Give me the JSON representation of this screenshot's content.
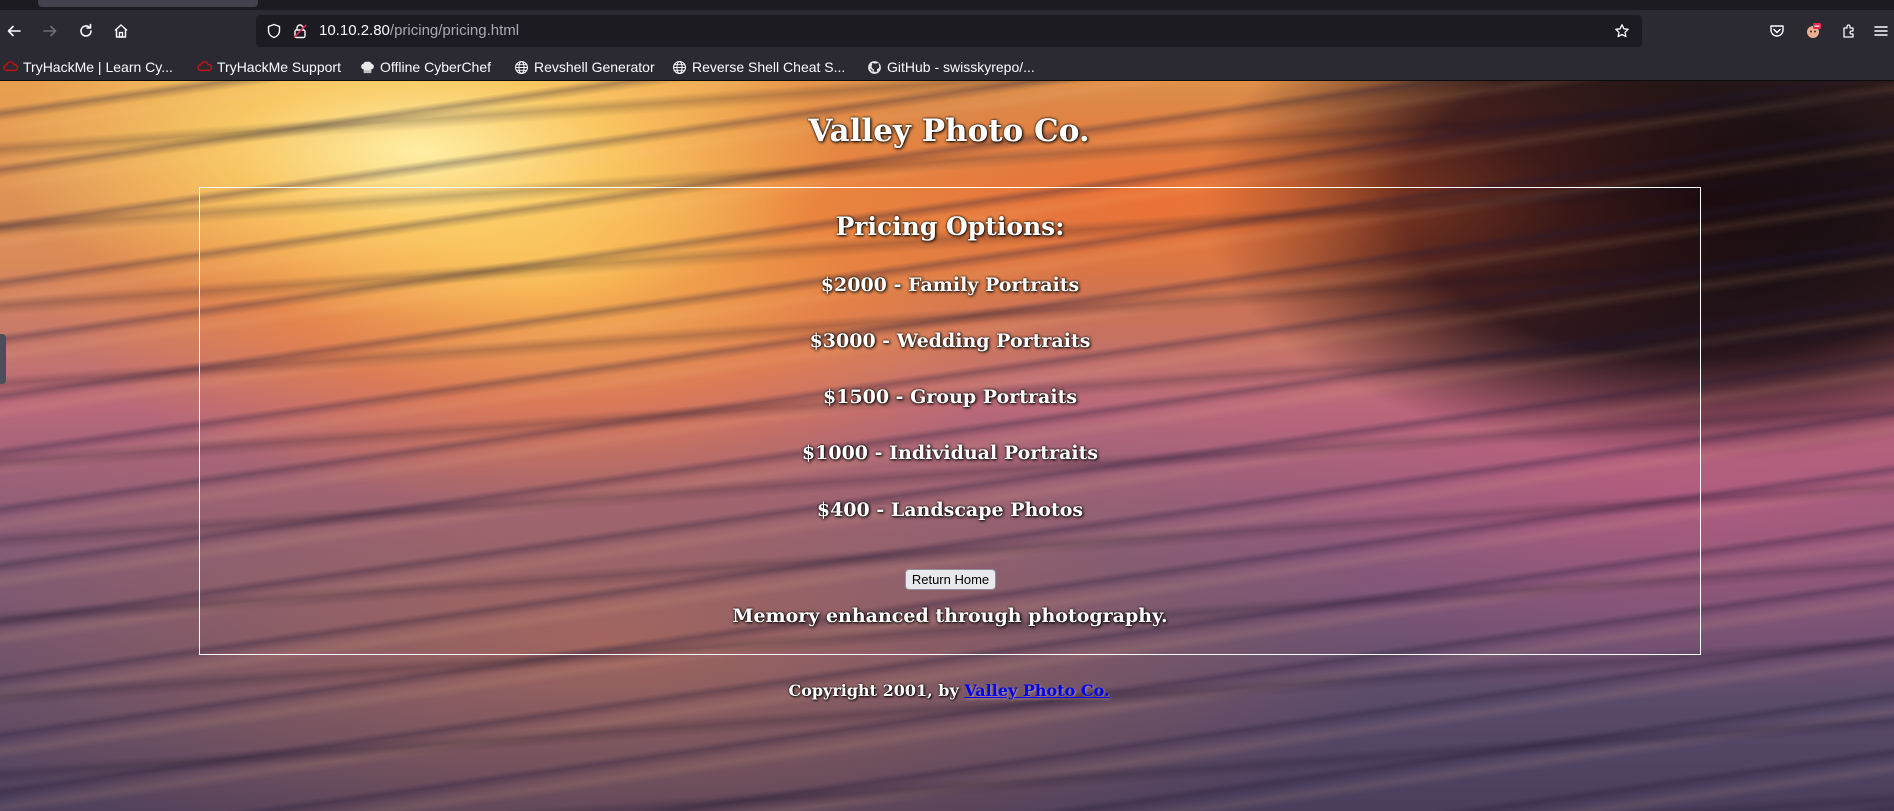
{
  "browser": {
    "url_host": "10.10.2.80",
    "url_path": "/pricing/pricing.html",
    "bookmarks": [
      {
        "label": "TryHackMe | Learn Cy...",
        "icon": "tryhackme-icon"
      },
      {
        "label": "TryHackMe Support",
        "icon": "tryhackme-icon"
      },
      {
        "label": "Offline CyberChef",
        "icon": "chef-hat-icon"
      },
      {
        "label": "Revshell Generator",
        "icon": "globe-icon"
      },
      {
        "label": "Reverse Shell Cheat S...",
        "icon": "globe-icon"
      },
      {
        "label": "GitHub - swisskyrepo/...",
        "icon": "github-icon"
      }
    ]
  },
  "page": {
    "site_title": "Valley Photo Co.",
    "heading": "Pricing Options:",
    "prices": [
      "$2000 - Family Portraits",
      "$3000 - Wedding Portraits",
      "$1500 - Group Portraits",
      "$1000 - Individual Portraits",
      "$400 - Landscape Photos"
    ],
    "return_button": "Return Home",
    "tagline": "Memory enhanced through photography.",
    "footer_prefix": "Copyright 2001, by ",
    "footer_link": "Valley Photo Co."
  },
  "colors": {
    "chrome_bg": "#2b2a33",
    "urlbar_bg": "#1c1b22",
    "link": "#0000ee",
    "text": "#ffffff"
  }
}
